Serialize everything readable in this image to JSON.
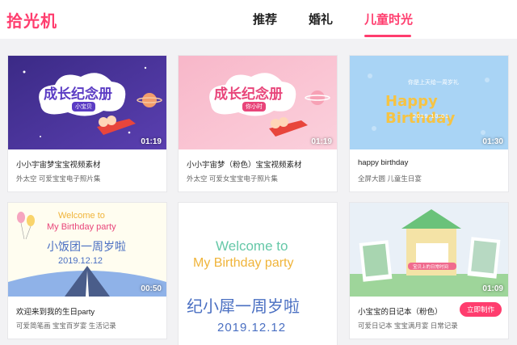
{
  "header": {
    "logo": "拾光机",
    "tabs": [
      {
        "label": "推荐"
      },
      {
        "label": "婚礼"
      },
      {
        "label": "儿童时光"
      }
    ],
    "active_color": "#ff3d6e"
  },
  "cards": [
    {
      "thumb_title": "成长纪念册",
      "thumb_tag": "小宝贝",
      "duration": "01:19",
      "title": "小小宇宙梦宝宝视频素材",
      "subtitle": "外太空 可爱宝宝电子照片集"
    },
    {
      "thumb_title": "成长纪念册",
      "thumb_tag": "你小时",
      "duration": "01:19",
      "title": "小小宇宙梦（粉色）宝宝视频素材",
      "subtitle": "外太空 可爱女宝宝电子照片集"
    },
    {
      "thumb_title": "Happy Birthday",
      "thumb_top": "你是上天给一周岁礼",
      "thumb_date": "2019.10.01",
      "duration": "01:30",
      "title": "happy birthday",
      "subtitle": "全屏大圆 儿童生日宴"
    },
    {
      "thumb_line1": "Welcome to",
      "thumb_line2": "My Birthday party",
      "thumb_cn": "小饭团一周岁啦",
      "thumb_date": "2019.12.12",
      "duration": "00:50",
      "title": "欢迎来到我的生日party",
      "subtitle": "可爱简笔画 宝宝百岁宴 生活记录"
    },
    {
      "thumb_line1": "Welcome to",
      "thumb_line2": "My Birthday party",
      "thumb_cn": "纪小犀一周岁啦",
      "thumb_date": "2019.12.12"
    },
    {
      "thumb_banner": "宝贝上的日常时间",
      "duration": "01:09",
      "title": "小宝宝的日记本（粉色）",
      "subtitle": "可爱日记本 宝宝满月宴 日常记录",
      "button": "立即制作"
    }
  ]
}
